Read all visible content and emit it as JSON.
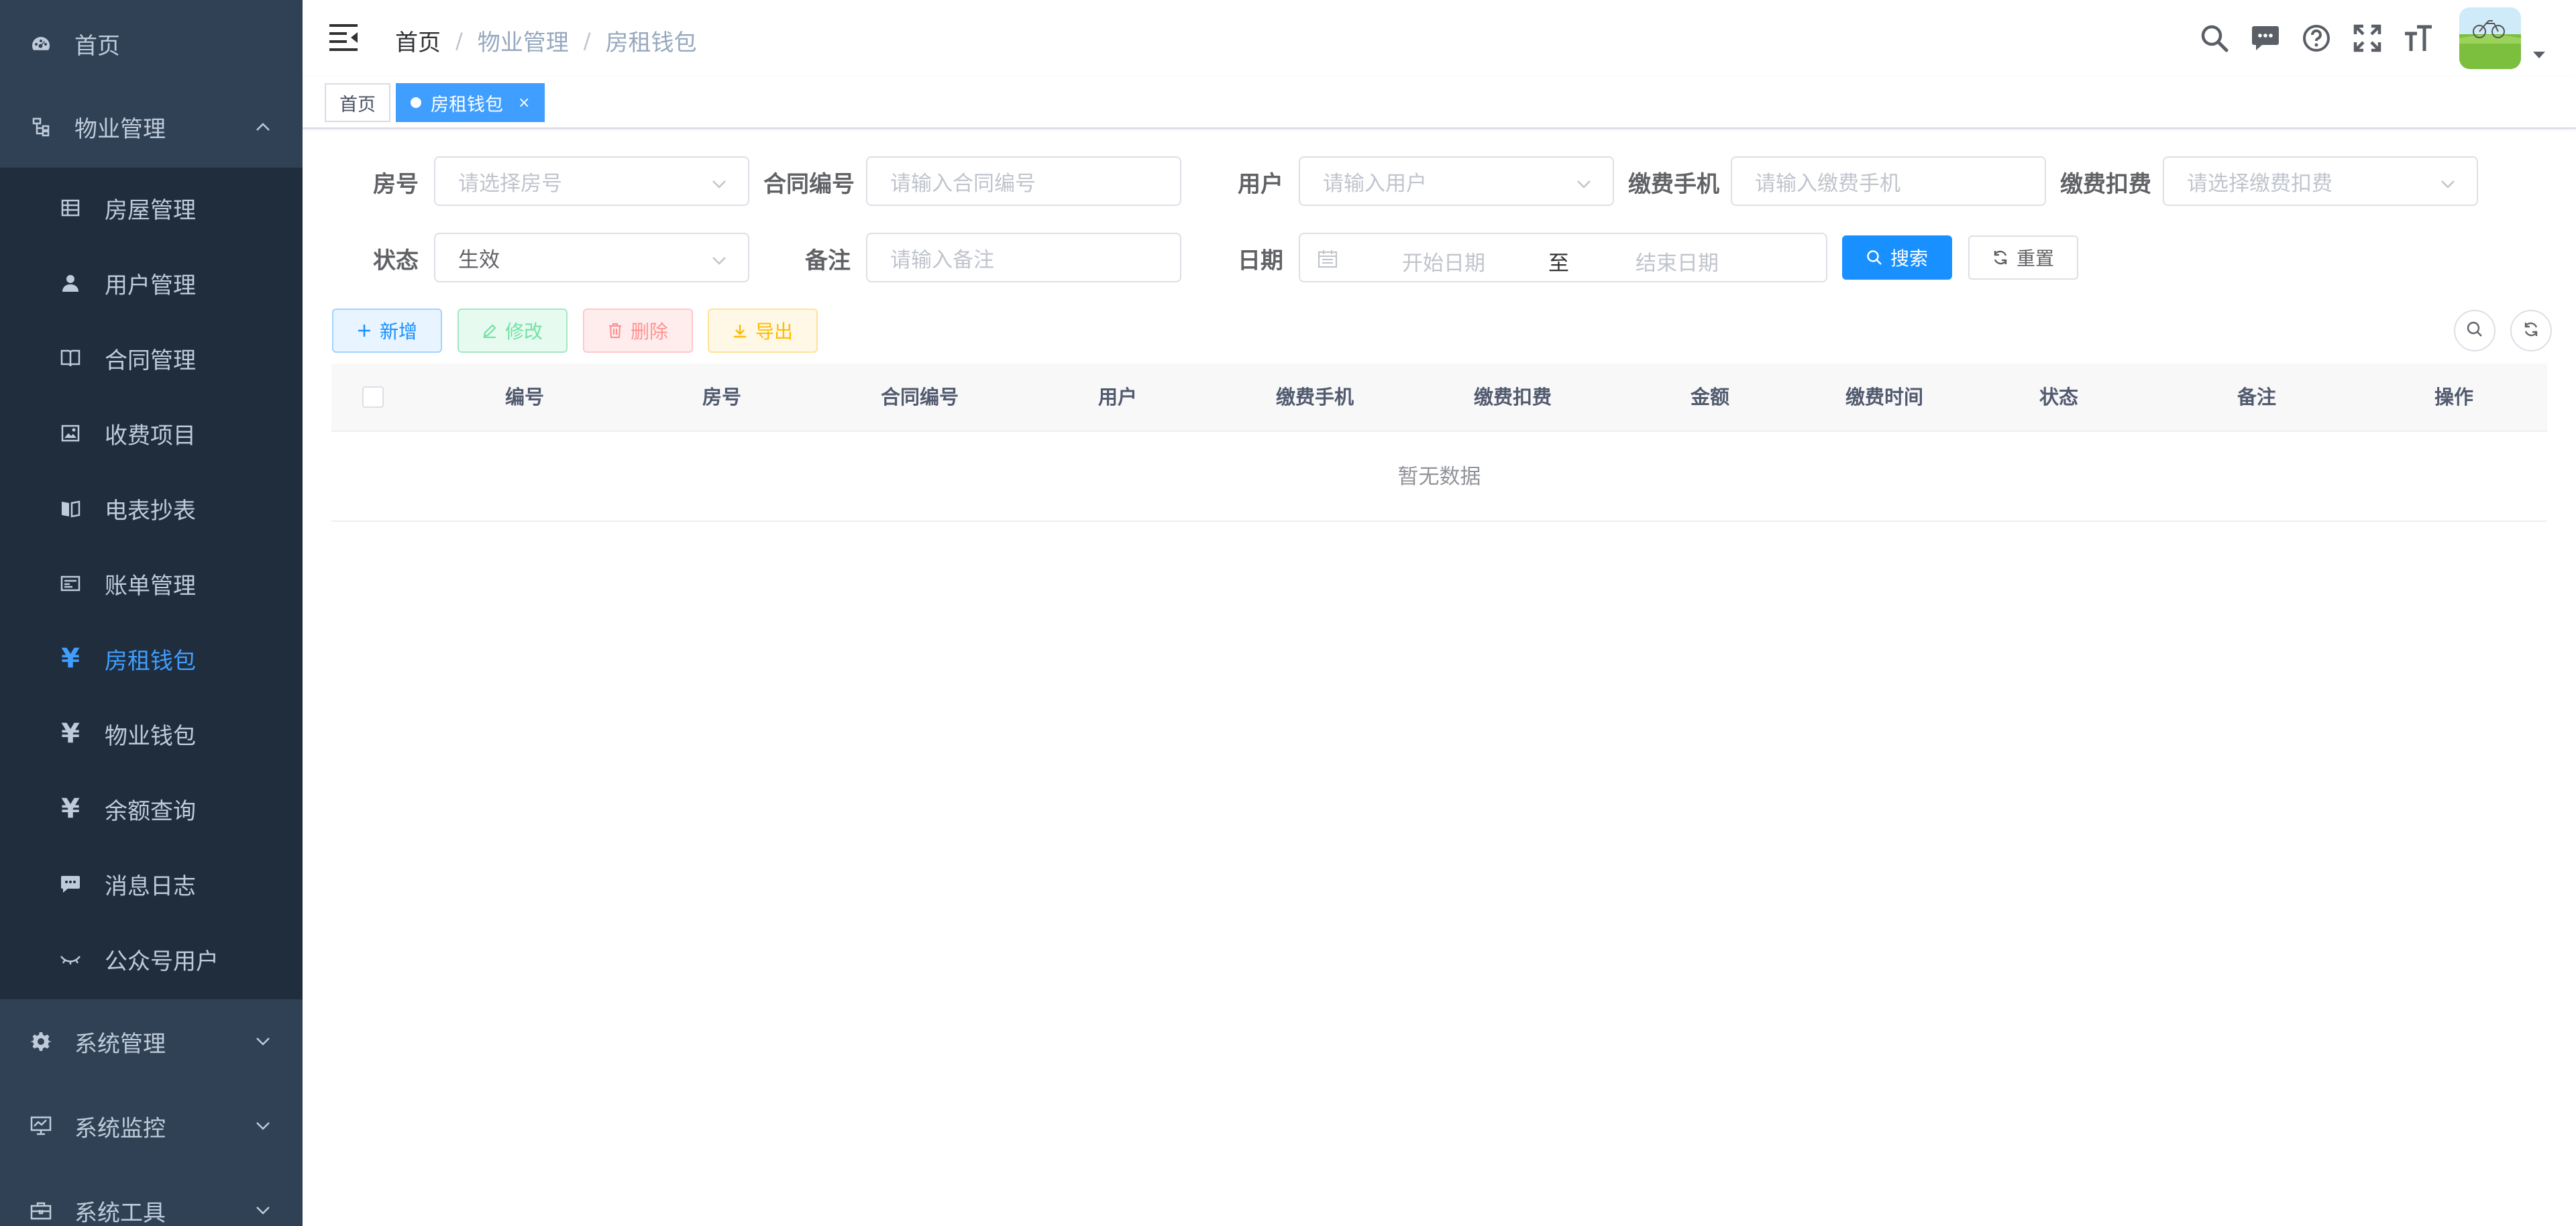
{
  "sidebar": {
    "items": [
      {
        "label": "首页",
        "icon": "dashboard-icon"
      },
      {
        "label": "物业管理",
        "icon": "tree-icon",
        "expanded": true
      },
      {
        "label": "系统管理",
        "icon": "gear-icon"
      },
      {
        "label": "系统监控",
        "icon": "monitor-icon"
      },
      {
        "label": "系统工具",
        "icon": "toolbox-icon"
      }
    ],
    "sub_items": [
      {
        "label": "房屋管理",
        "icon": "table-icon"
      },
      {
        "label": "用户管理",
        "icon": "user-icon"
      },
      {
        "label": "合同管理",
        "icon": "book-icon"
      },
      {
        "label": "收费项目",
        "icon": "image-icon"
      },
      {
        "label": "电表抄表",
        "icon": "documentation-icon"
      },
      {
        "label": "账单管理",
        "icon": "bill-icon"
      },
      {
        "label": "房租钱包",
        "icon": "yen-icon",
        "active": true
      },
      {
        "label": "物业钱包",
        "icon": "yen-icon"
      },
      {
        "label": "余额查询",
        "icon": "yen-icon"
      },
      {
        "label": "消息日志",
        "icon": "message-icon"
      },
      {
        "label": "公众号用户",
        "icon": "eye-icon"
      }
    ],
    "yen_symbol": "¥"
  },
  "navbar": {
    "breadcrumb": [
      "首页",
      "物业管理",
      "房租钱包"
    ],
    "separator": "/"
  },
  "tags": [
    {
      "label": "首页",
      "active": false
    },
    {
      "label": "房租钱包",
      "active": true,
      "close": "×"
    }
  ],
  "filters": {
    "room": {
      "label": "房号",
      "placeholder": "请选择房号"
    },
    "contract_no": {
      "label": "合同编号",
      "placeholder": "请输入合同编号"
    },
    "user": {
      "label": "用户",
      "placeholder": "请输入用户"
    },
    "phone": {
      "label": "缴费手机",
      "placeholder": "请输入缴费手机"
    },
    "deduct": {
      "label": "缴费扣费",
      "placeholder": "请选择缴费扣费"
    },
    "status": {
      "label": "状态",
      "value": "生效"
    },
    "remark": {
      "label": "备注",
      "placeholder": "请输入备注"
    },
    "date": {
      "label": "日期",
      "start_placeholder": "开始日期",
      "separator": "至",
      "end_placeholder": "结束日期"
    }
  },
  "buttons": {
    "search": "搜索",
    "reset": "重置",
    "add": "新增",
    "edit": "修改",
    "delete": "删除",
    "export": "导出"
  },
  "table": {
    "columns": [
      "编号",
      "房号",
      "合同编号",
      "用户",
      "缴费手机",
      "缴费扣费",
      "金额",
      "缴费时间",
      "状态",
      "备注",
      "操作"
    ],
    "empty_text": "暂无数据"
  },
  "colors": {
    "sidebar_bg": "#304156",
    "submenu_bg": "#1f2d3d",
    "accent": "#409eff",
    "primary_button": "#1890ff"
  }
}
